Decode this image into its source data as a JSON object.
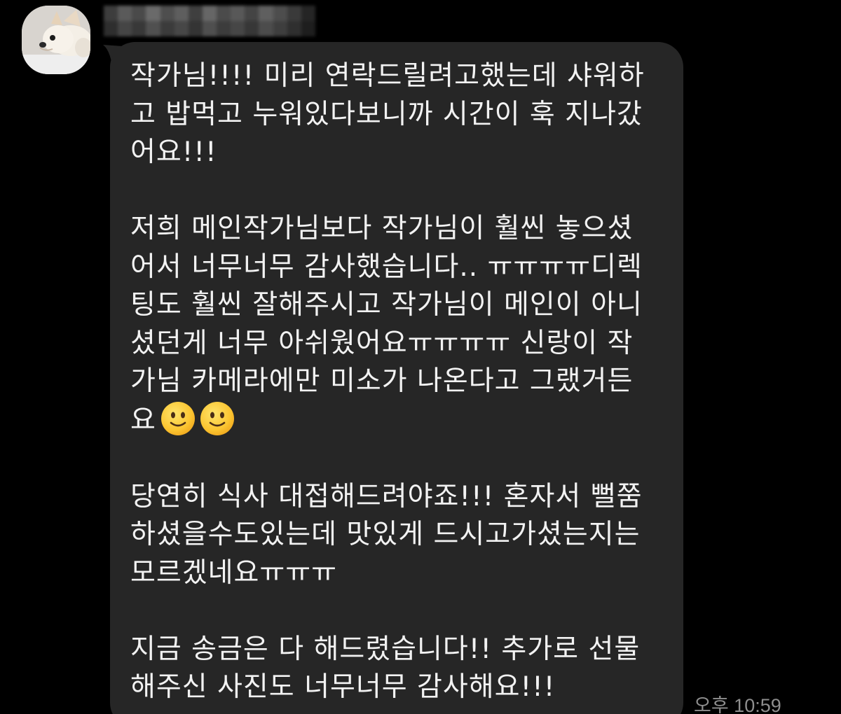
{
  "chat": {
    "avatar_icon": "chihuahua-profile-photo",
    "sender_name_blurred": "",
    "message": {
      "lines": [
        "작가님!!!! 미리 연락드릴려고했는데 샤워하",
        "고 밥먹고 누워있다보니까 시간이 훅 지나갔",
        "어요!!!",
        "",
        "저희 메인작가님보다 작가님이 훨씬 놓으셨",
        "어서 너무너무 감사했습니다.. ㅠㅠㅠㅠ디렉",
        "팅도 훨씬 잘해주시고 작가님이 메인이 아니",
        "셨던게 너무 아쉬웠어요ㅠㅠㅠㅠ 신랑이 작",
        "가님 카메라에만 미소가 나온다고 그랬거든",
        "요",
        "",
        "당연히 식사 대접해드려야죠!!! 혼자서 뻘쭘",
        "하셨을수도있는데 맛있게 드시고가셨는지는",
        "모르겠네요ㅠㅠㅠ",
        "",
        "지금 송금은 다 해드렸습니다!! 추가로 선물",
        "해주신 사진도 너무너무 감사해요!!!"
      ],
      "emoji_icons": [
        "slightly-smiling-face-emoji",
        "slightly-smiling-face-emoji"
      ]
    },
    "timestamp": "오후 10:59",
    "colors": {
      "background": "#000000",
      "bubble": "#262626",
      "text": "#f2f2f2",
      "timestamp": "#8e8e8e"
    }
  }
}
